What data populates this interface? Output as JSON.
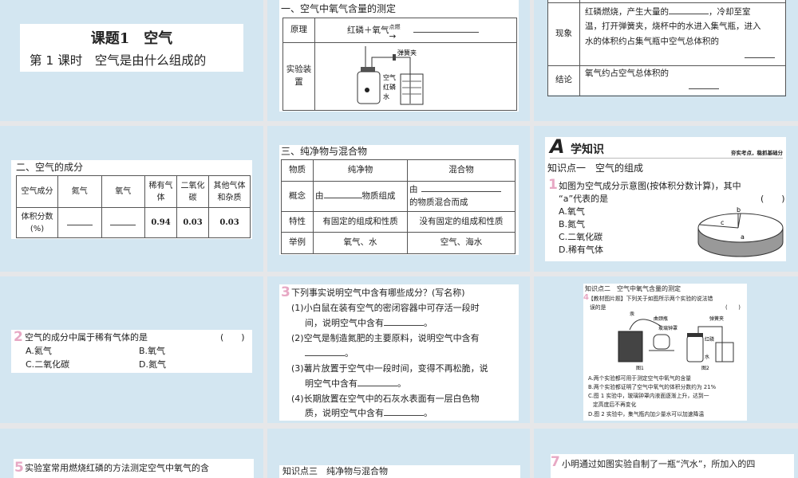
{
  "slide1": {
    "title": "课题1　空气",
    "subtitle": "第 1 课时　空气是由什么组成的"
  },
  "slide2": {
    "heading": "一、空气中氧气含量的测定",
    "row1_label": "原理",
    "reaction": "红磷＋氧气",
    "condition": "点燃",
    "row2_label": "实验装置",
    "diagram_labels": [
      "弹簧夹",
      "空气",
      "红磷",
      "水"
    ]
  },
  "slide3": {
    "row1_label": "现象",
    "row1_text": [
      "红磷燃烧，产生大量的",
      "，冷却至室",
      "温，打开弹簧夹，烧杯中的水进入集气瓶，进入",
      "水的体积约占集气瓶中空气总体积的"
    ],
    "row2_label": "结论",
    "row2_text": "氧气约占空气总体积的"
  },
  "slide4": {
    "heading": "二、空气的成分",
    "headers": [
      "空气成分",
      "氮气",
      "氧气",
      "稀有气体",
      "二氧化碳",
      "其他气体和杂质"
    ],
    "row_label": "体积分数(%)",
    "values": [
      "",
      "",
      "0.94",
      "0.03",
      "0.03"
    ]
  },
  "slide5": {
    "heading": "三、纯净物与混合物",
    "headers": [
      "物质",
      "纯净物",
      "混合物"
    ],
    "rows": [
      {
        "label": "概念",
        "pure": [
          "由",
          "物质组成"
        ],
        "mix": [
          "由",
          "的物质混合而成"
        ]
      },
      {
        "label": "特性",
        "pure": "有固定的组成和性质",
        "mix": "没有固定的组成和性质"
      },
      {
        "label": "举例",
        "pure": "氧气、水",
        "mix": "空气、海水"
      }
    ]
  },
  "slide6": {
    "badge": "A",
    "banner": "学知识",
    "tagline": "夯实考点，稳抓基础分",
    "section": "知识点一　空气的组成",
    "number": "1",
    "question": [
      "如图为空气成分示意图(按体积分数计算)，其中",
      "“a”代表的是"
    ],
    "bracket": "(　　)",
    "options": [
      "A.氧气",
      "B.氮气",
      "C.二氧化碳",
      "D.稀有气体"
    ],
    "pie_labels": [
      "a",
      "b",
      "c"
    ]
  },
  "slide7": {
    "number": "2",
    "question": "空气的成分中属于稀有气体的是",
    "bracket": "(　　)",
    "options": [
      "A.氦气",
      "B.氧气",
      "C.二氧化碳",
      "D.氮气"
    ]
  },
  "slide8": {
    "number": "3",
    "question": "下列事实说明空气中含有哪些成分？(写名称)",
    "items": [
      [
        "(1)小白鼠在装有空气的密闭容器中可存活一段时",
        "间，说明空气中含有"
      ],
      [
        "(2)空气是制造氮肥的主要原料，说明空气中含有",
        ""
      ],
      [
        "(3)薯片放置于空气中一段时间，变得不再松脆，说",
        "明空气中含有"
      ],
      [
        "(4)长期放置在空气中的石灰水表面有一层白色物",
        "质，说明空气中含有"
      ]
    ],
    "period": "。"
  },
  "slide9": {
    "section": "知识点二　空气中氧气含量的测定",
    "number": "4",
    "question": [
      "【教材图片题】下列关于如图所示两个实验的说法错",
      "误的是"
    ],
    "bracket": "(　　)",
    "fig1_labels": [
      "汞",
      "曲颈瓶",
      "玻璃钟罩"
    ],
    "fig2_labels": [
      "弹簧夹",
      "红磷",
      "水"
    ],
    "fig_captions": [
      "图1",
      "图2"
    ],
    "options": [
      "A.两个实验都可用于测定空气中氧气的含量",
      "B.两个实验都证明了空气中氧气的体积分数约为 21%",
      "C.图 1 实验中，玻璃钟罩内液面逐渐上升，达到一",
      "定高度后不再变化",
      "D.图 2 实验中，集气瓶内加少量水可以加速降温"
    ]
  },
  "slide10": {
    "number": "5",
    "text": "实验室常用燃烧红磷的方法测定空气中氧气的含"
  },
  "slide11": {
    "text": "知识点三　纯净物与混合物"
  },
  "slide12": {
    "number": "7",
    "text": "小明通过如图实验自制了一瓶“汽水”，所加入的四"
  }
}
